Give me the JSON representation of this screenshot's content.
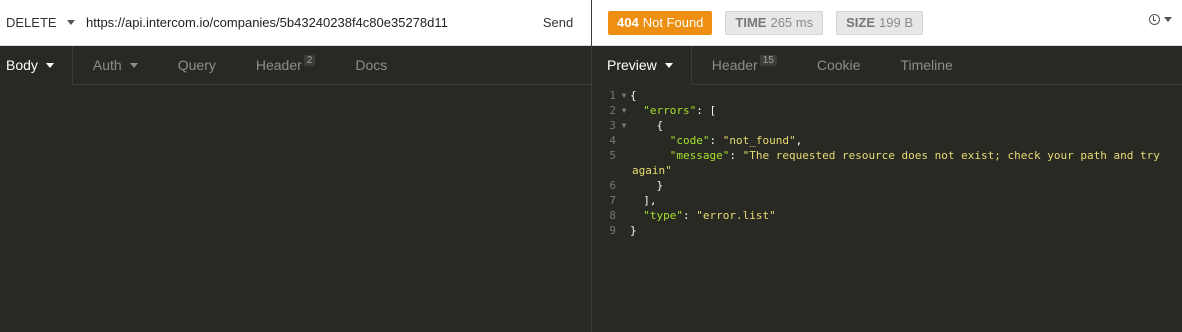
{
  "request": {
    "method": "DELETE",
    "url": "https://api.intercom.io/companies/5b43240238f4c80e35278d11",
    "send_label": "Send",
    "tabs": [
      {
        "label": "Body"
      },
      {
        "label": "Auth"
      },
      {
        "label": "Query"
      },
      {
        "label": "Header",
        "badge": "2"
      },
      {
        "label": "Docs"
      }
    ]
  },
  "response": {
    "status_code": "404",
    "status_text": "Not Found",
    "status_color": "#ee8e12",
    "time_label": "TIME",
    "time_value": "265 ms",
    "size_label": "SIZE",
    "size_value": "199 B",
    "history_icon": "clock-icon",
    "tabs": [
      {
        "label": "Preview"
      },
      {
        "label": "Header",
        "badge": "15"
      },
      {
        "label": "Cookie"
      },
      {
        "label": "Timeline"
      }
    ],
    "body_lines": [
      {
        "n": "1",
        "fold": true
      },
      {
        "n": "2",
        "fold": true
      },
      {
        "n": "3",
        "fold": true
      },
      {
        "n": "4",
        "fold": false
      },
      {
        "n": "5",
        "fold": false
      },
      {
        "n": "6",
        "fold": false
      },
      {
        "n": "7",
        "fold": false
      },
      {
        "n": "8",
        "fold": false
      },
      {
        "n": "9",
        "fold": false
      }
    ],
    "json": {
      "key_errors": "\"errors\"",
      "key_code": "\"code\"",
      "val_code": "\"not_found\"",
      "key_message": "\"message\"",
      "val_message_part1": "\"The requested resource does not exist; check your path and try",
      "val_message_part2": "again\"",
      "key_type": "\"type\"",
      "val_type": "\"error.list\""
    }
  }
}
